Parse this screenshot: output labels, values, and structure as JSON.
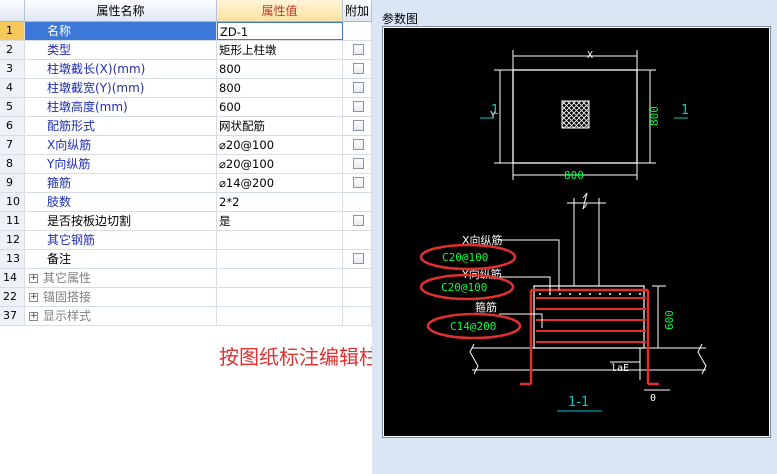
{
  "grid": {
    "headers": {
      "name": "属性名称",
      "value": "属性值",
      "add": "附加"
    },
    "rows": [
      {
        "num": "1",
        "name": "名称",
        "value": "ZD-1",
        "checkbox": false,
        "selected": true,
        "color": "blue"
      },
      {
        "num": "2",
        "name": "类型",
        "value": "矩形上柱墩",
        "checkbox": true,
        "color": "blue"
      },
      {
        "num": "3",
        "name": "柱墩截长(X)(mm)",
        "value": "800",
        "checkbox": true,
        "color": "blue"
      },
      {
        "num": "4",
        "name": "柱墩截宽(Y)(mm)",
        "value": "800",
        "checkbox": true,
        "color": "blue"
      },
      {
        "num": "5",
        "name": "柱墩高度(mm)",
        "value": "600",
        "checkbox": true,
        "color": "blue"
      },
      {
        "num": "6",
        "name": "配筋形式",
        "value": "网状配筋",
        "checkbox": true,
        "color": "blue"
      },
      {
        "num": "7",
        "name": "X向纵筋",
        "value": "⌀20@100",
        "checkbox": true,
        "color": "blue"
      },
      {
        "num": "8",
        "name": "Y向纵筋",
        "value": "⌀20@100",
        "checkbox": true,
        "color": "blue"
      },
      {
        "num": "9",
        "name": "箍筋",
        "value": "⌀14@200",
        "checkbox": true,
        "color": "blue"
      },
      {
        "num": "10",
        "name": "肢数",
        "value": "2*2",
        "checkbox": false,
        "color": "blue"
      },
      {
        "num": "11",
        "name": "是否按板边切割",
        "value": "是",
        "checkbox": true,
        "color": "black"
      },
      {
        "num": "12",
        "name": "其它钢筋",
        "value": "",
        "checkbox": false,
        "color": "blue"
      },
      {
        "num": "13",
        "name": "备注",
        "value": "",
        "checkbox": true,
        "color": "black"
      },
      {
        "num": "14",
        "name": "其它属性",
        "value": "",
        "checkbox": false,
        "color": "gray",
        "group": true
      },
      {
        "num": "22",
        "name": "锚固搭接",
        "value": "",
        "checkbox": false,
        "color": "gray",
        "group": true
      },
      {
        "num": "37",
        "name": "显示样式",
        "value": "",
        "checkbox": false,
        "color": "gray",
        "group": true
      }
    ]
  },
  "instruction": "按图纸标注编辑柱墩信息",
  "panel": {
    "title": "参数图",
    "drawing": {
      "plan_x": "X",
      "plan_y": "Y",
      "plan_width_dim": "800",
      "plan_height_dim": "800",
      "section_mark_left": "1",
      "section_mark_right": "1",
      "x_bar_label": "X向纵筋",
      "x_bar_value": "C20@100",
      "y_bar_label": "Y向纵筋",
      "y_bar_value": "C20@100",
      "stirrup_label": "箍筋",
      "stirrup_value": "C14@200",
      "height_dim": "600",
      "anchor_label": "laE",
      "zero_label": "0",
      "section_title": "1-1"
    },
    "colors": {
      "canvas": "#000000",
      "lines": "#ffffff",
      "rebar": "#e0302a",
      "dims": "#00ff40",
      "marks": "#00c8c8",
      "ellipse": "#e03030"
    }
  }
}
